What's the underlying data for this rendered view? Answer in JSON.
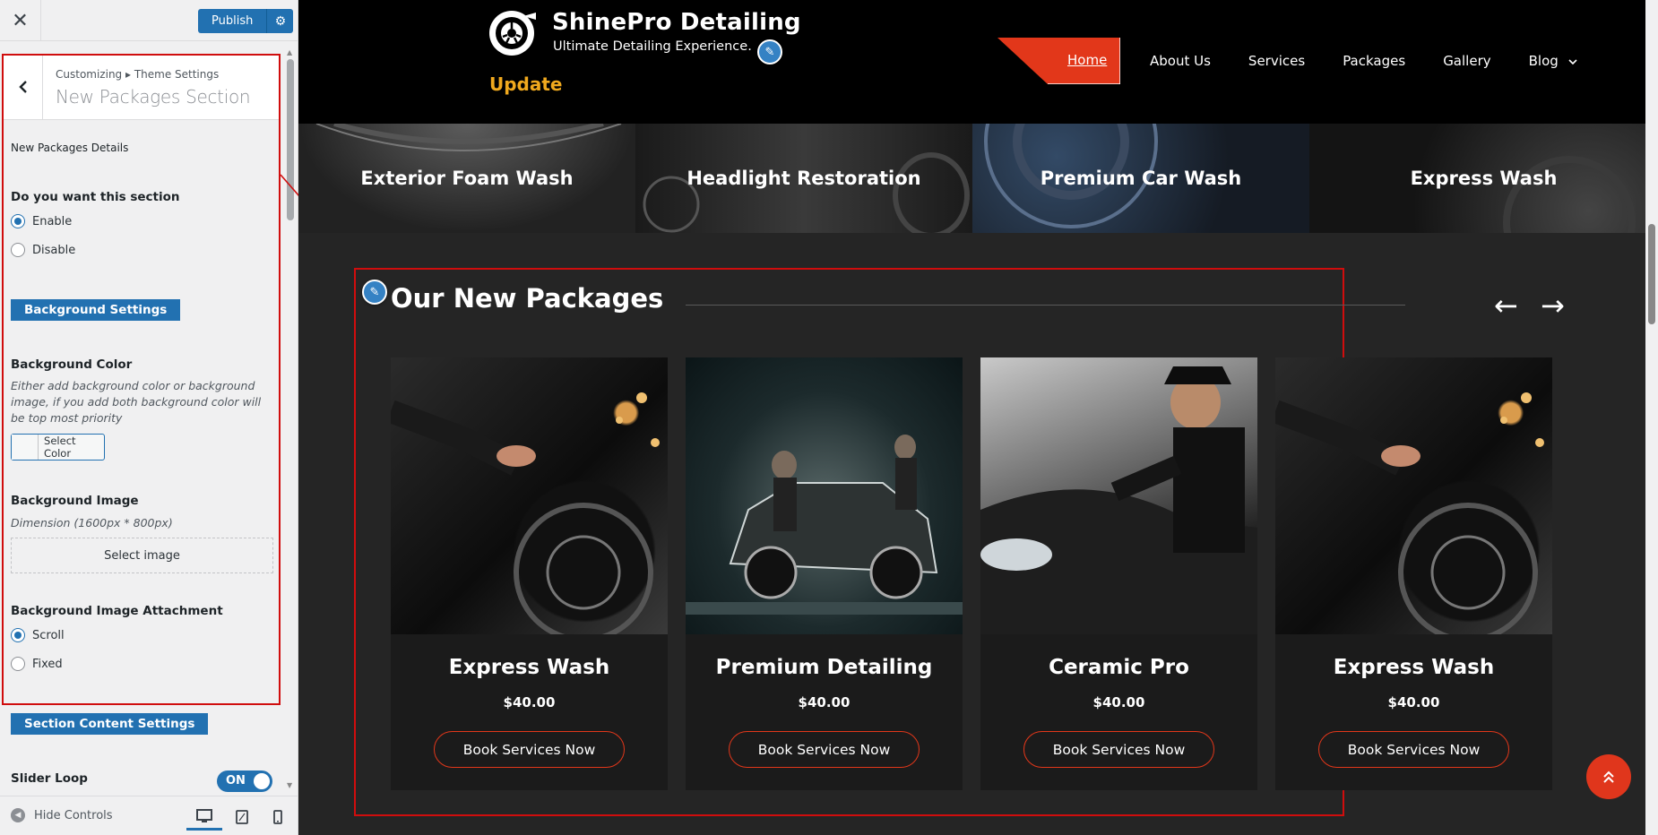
{
  "customizer": {
    "close_label": "✕",
    "publish_label": "Publish",
    "gear_icon": "⚙",
    "back_icon": "‹",
    "breadcrumb": "Customizing ▸ Theme Settings",
    "section_title": "New Packages Section",
    "details_label": "New Packages Details",
    "section_question": "Do you want this section",
    "enable_label": "Enable",
    "disable_label": "Disable",
    "section_enabled": true,
    "bg_settings_header": "Background Settings",
    "bg_color_label": "Background Color",
    "bg_color_desc": "Either add background color or background image, if you add both background color will be top most priority",
    "select_color_label": "Select Color",
    "bg_image_label": "Background Image",
    "bg_image_desc": "Dimension (1600px * 800px)",
    "select_image_label": "Select image",
    "bg_attach_label": "Background Image Attachment",
    "scroll_label": "Scroll",
    "fixed_label": "Fixed",
    "attachment_selected": "Scroll",
    "content_settings_header": "Section Content Settings",
    "slider_loop_label": "Slider Loop",
    "slider_loop_state": "ON",
    "hide_controls_label": "Hide Controls",
    "active_device": "desktop",
    "accent_color": "#2271b1"
  },
  "site": {
    "logo_title": "ShinePro Detailing",
    "logo_tagline": "Ultimate Detailing Experience.",
    "update_label": "Update",
    "nav": [
      "Home",
      "About Us",
      "Services",
      "Packages",
      "Gallery",
      "Blog"
    ],
    "nav_active": "Home",
    "blog_chevron": "⌄",
    "brand_color": "#e2371a",
    "services": [
      "Exterior Foam Wash",
      "Headlight Restoration",
      "Premium Car Wash",
      "Express Wash"
    ],
    "packages_title": "Our New Packages",
    "prev_arrow": "←",
    "next_arrow": "→",
    "packages": [
      {
        "name": "Express Wash",
        "price": "$40.00",
        "button": "Book Services Now"
      },
      {
        "name": "Premium Detailing",
        "price": "$40.00",
        "button": "Book Services Now"
      },
      {
        "name": "Ceramic Pro",
        "price": "$40.00",
        "button": "Book Services Now"
      },
      {
        "name": "Express Wash",
        "price": "$40.00",
        "button": "Book Services Now"
      }
    ],
    "scroll_top_icon": "⌃"
  }
}
